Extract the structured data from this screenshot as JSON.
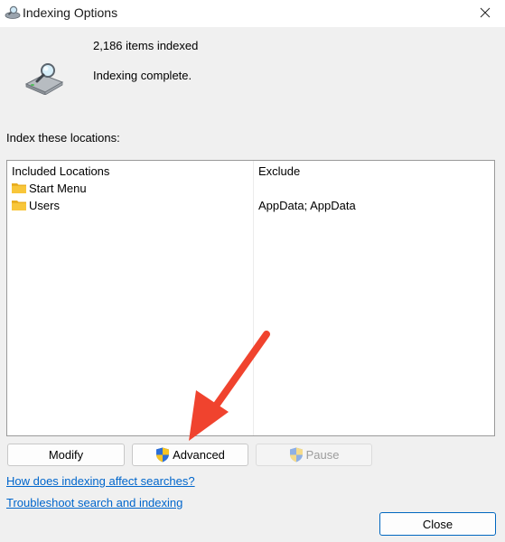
{
  "window": {
    "title": "Indexing Options"
  },
  "status": {
    "items_indexed": "2,186 items indexed",
    "state": "Indexing complete."
  },
  "locations": {
    "label": "Index these locations:",
    "headers": {
      "included": "Included Locations",
      "exclude": "Exclude"
    },
    "rows": [
      {
        "name": "Start Menu",
        "exclude": ""
      },
      {
        "name": "Users",
        "exclude": "AppData; AppData"
      }
    ]
  },
  "buttons": {
    "modify": "Modify",
    "advanced": "Advanced",
    "pause": "Pause",
    "close": "Close"
  },
  "links": {
    "affect_searches": "How does indexing affect searches?",
    "troubleshoot": "Troubleshoot search and indexing"
  },
  "colors": {
    "annotation_arrow": "#f0432e",
    "link": "#0066cc",
    "folder": "#f8c63a"
  }
}
